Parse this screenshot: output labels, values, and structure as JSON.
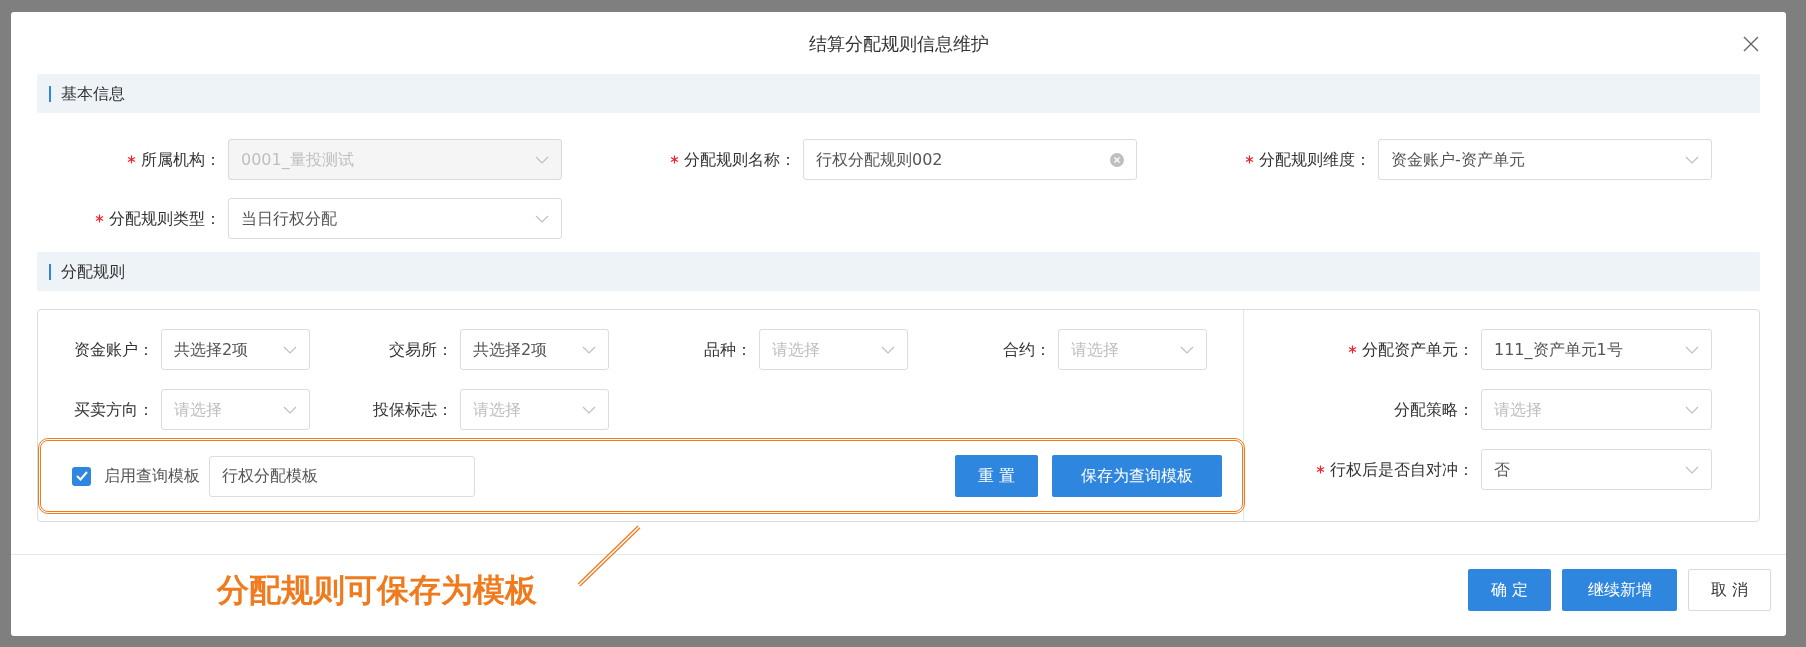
{
  "dialog": {
    "title": "结算分配规则信息维护"
  },
  "basic_info": {
    "title": "基本信息",
    "fields": [
      {
        "label": "所属机构：",
        "required": true,
        "kind": "select",
        "value": "0001_量投测试",
        "disabled": true
      },
      {
        "label": "分配规则名称：",
        "required": true,
        "kind": "text",
        "value": "行权分配规则002",
        "disabled": false
      },
      {
        "label": "分配规则维度：",
        "required": true,
        "kind": "select",
        "value": "资金账户-资产单元",
        "disabled": false
      },
      {
        "label": "分配规则类型：",
        "required": true,
        "kind": "select",
        "value": "当日行权分配",
        "disabled": false
      }
    ]
  },
  "rules": {
    "title": "分配规则",
    "filters": [
      {
        "label": "资金账户：",
        "value": "共选择2项"
      },
      {
        "label": "交易所：",
        "value": "共选择2项"
      },
      {
        "label": "品种：",
        "placeholder": "请选择"
      },
      {
        "label": "合约：",
        "placeholder": "请选择"
      },
      {
        "label": "买卖方向：",
        "placeholder": "请选择"
      },
      {
        "label": "投保标志：",
        "placeholder": "请选择"
      }
    ],
    "template": {
      "checked": true,
      "label": "启用查询模板",
      "value": "行权分配模板"
    },
    "buttons": [
      "重 置",
      "保存为查询模板"
    ],
    "settings": [
      {
        "label": "分配资产单元：",
        "required": true,
        "value": "111_资产单元1号"
      },
      {
        "label": "分配策略：",
        "required": false,
        "placeholder": "请选择"
      },
      {
        "label": "行权后是否自对冲：",
        "required": true,
        "value": "否"
      }
    ]
  },
  "footer_buttons": [
    {
      "label": "确 定",
      "kind": "primary"
    },
    {
      "label": "继续新增",
      "kind": "primary"
    },
    {
      "label": "取 消",
      "kind": "default"
    }
  ],
  "annotation": {
    "text": "分配规则可保存为模板"
  }
}
